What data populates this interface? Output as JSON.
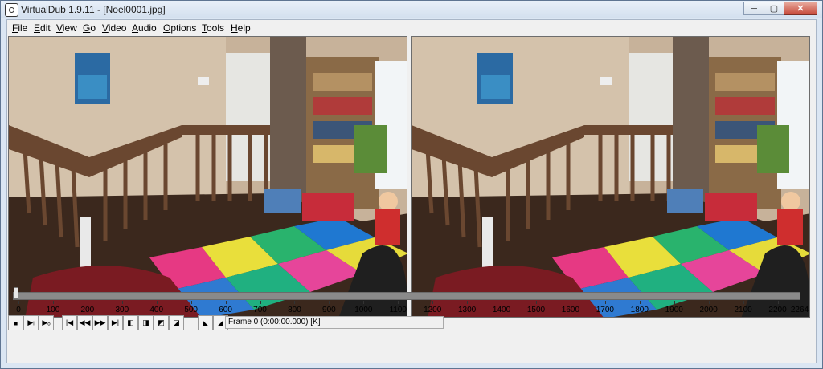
{
  "window": {
    "title": "VirtualDub 1.9.11 - [Noel0001.jpg]",
    "controls": {
      "minimize": "─",
      "maximize": "▢",
      "close": "✕"
    }
  },
  "menu": [
    {
      "hot": "F",
      "rest": "ile"
    },
    {
      "hot": "E",
      "rest": "dit"
    },
    {
      "hot": "V",
      "rest": "iew"
    },
    {
      "hot": "G",
      "rest": "o"
    },
    {
      "hot": "V",
      "rest": "ideo"
    },
    {
      "hot": "A",
      "rest": "udio"
    },
    {
      "hot": "O",
      "rest": "ptions"
    },
    {
      "hot": "T",
      "rest": "ools"
    },
    {
      "hot": "H",
      "rest": "elp"
    }
  ],
  "panes": {
    "input": "input-video-pane",
    "output": "output-video-pane"
  },
  "timeline": {
    "max": 2264,
    "position": 0,
    "labels": [
      "0",
      "100",
      "200",
      "300",
      "400",
      "500",
      "600",
      "700",
      "800",
      "900",
      "1000",
      "1100",
      "1200",
      "1300",
      "1400",
      "1500",
      "1600",
      "1700",
      "1800",
      "1900",
      "2000",
      "2100",
      "2200",
      "2264"
    ]
  },
  "toolbar": {
    "buttons": [
      {
        "name": "stop-icon",
        "glyph": "■"
      },
      {
        "name": "play-input-icon",
        "glyph": "▶ᵢ"
      },
      {
        "name": "play-output-icon",
        "glyph": "▶ₒ"
      },
      {
        "name": "start-icon",
        "glyph": "|◀"
      },
      {
        "name": "prev-frame-icon",
        "glyph": "◀◀"
      },
      {
        "name": "next-frame-icon",
        "glyph": "▶▶"
      },
      {
        "name": "end-icon",
        "glyph": "▶|"
      },
      {
        "name": "prev-key-icon",
        "glyph": "◧"
      },
      {
        "name": "next-key-icon",
        "glyph": "◨"
      },
      {
        "name": "scene-back-icon",
        "glyph": "◩"
      },
      {
        "name": "scene-fwd-icon",
        "glyph": "◪"
      },
      {
        "name": "mark-in-icon",
        "glyph": "◣"
      },
      {
        "name": "mark-out-icon",
        "glyph": "◢"
      }
    ],
    "status": "Frame 0 (0:00:00.000) [K]"
  }
}
